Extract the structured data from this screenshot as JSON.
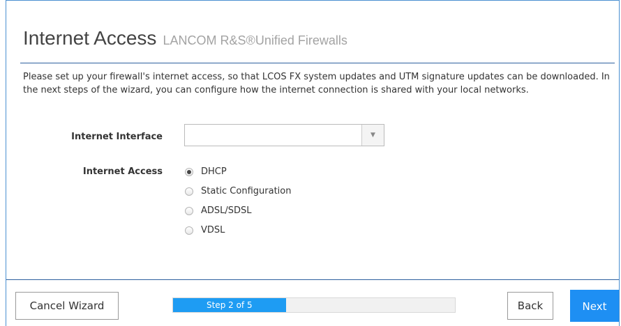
{
  "header": {
    "title": "Internet Access",
    "subtitle": "LANCOM R&S®Unified Firewalls"
  },
  "description": "Please set up your firewall's internet access, so that LCOS FX system updates and UTM signature updates can be downloaded. In the next steps of the wizard, you can configure how the internet connection is shared with your local networks.",
  "form": {
    "interface_label": "Internet Interface",
    "interface_value": "",
    "access_label": "Internet Access",
    "access_options": [
      {
        "label": "DHCP",
        "checked": true
      },
      {
        "label": "Static Configuration",
        "checked": false
      },
      {
        "label": "ADSL/SDSL",
        "checked": false
      },
      {
        "label": "VDSL",
        "checked": false
      }
    ]
  },
  "footer": {
    "cancel_label": "Cancel Wizard",
    "back_label": "Back",
    "next_label": "Next",
    "progress_text": "Step 2 of 5",
    "progress_fraction": 0.4
  },
  "colors": {
    "accent": "#1e8ff3",
    "progress": "#1e9cf3",
    "frame_border": "#4a8fd1"
  },
  "icons": {
    "dropdown": "chevron-down-icon"
  }
}
